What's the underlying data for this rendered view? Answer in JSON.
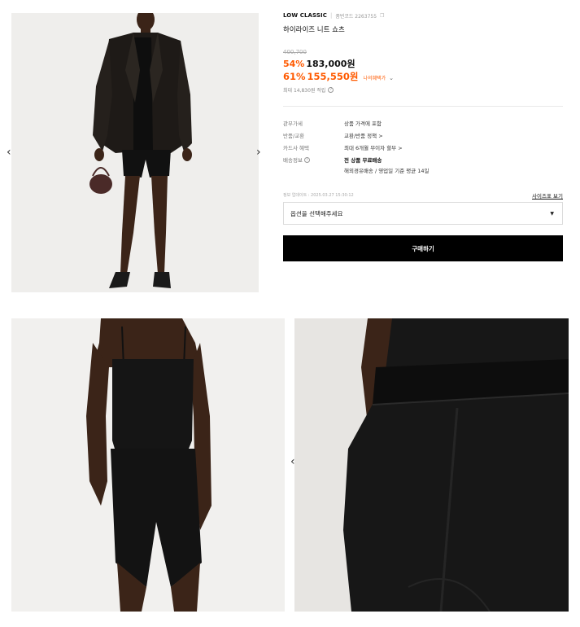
{
  "product": {
    "brand": "LOW CLASSIC",
    "brand_separator": "|",
    "product_no": "품번코드 2263755",
    "copy_icon": "copy-icon",
    "title": "하이라이즈 니트 쇼츠",
    "original_price": "400,700",
    "discount_rate": "54%",
    "sale_price": "183,000원",
    "member_discount_rate": "61%",
    "member_price": "155,550원",
    "my_benefit_label": "나의혜택가",
    "points_text": "최대 14,830원 적립"
  },
  "specs": [
    {
      "label": "관부가세",
      "value": "상품 가격에 포함"
    },
    {
      "label": "반품/교환",
      "value": "교환/반품 정책 >"
    },
    {
      "label": "카드사 혜택",
      "value": "최대 6개월 무이자 할부 >"
    },
    {
      "label": "배송정보",
      "value": "전 상품 무료배송",
      "value2": "해외경유배송 / 영업일 기준 평균 14일"
    }
  ],
  "update_time": "정보 업데이트 : 2025.03.27 15:30:12",
  "size_guide_label": "사이즈표 보기",
  "option": {
    "placeholder": "옵션을 선택해주세요",
    "caret": "▼"
  },
  "buy_label": "구매하기",
  "arrows": {
    "left": "‹",
    "right": "›"
  },
  "colors": {
    "accent": "#ff5a00",
    "button": "#000000",
    "garment": "#141414",
    "skin": "#3b2418"
  }
}
